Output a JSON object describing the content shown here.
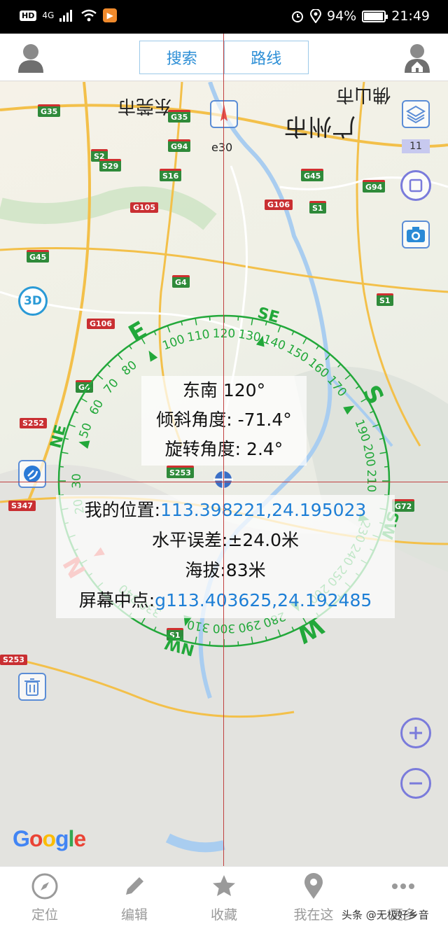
{
  "status_bar": {
    "hd": "HD",
    "network": "4G",
    "battery_text": "94%",
    "battery_level": 0.94,
    "time": "21:49"
  },
  "top_bar": {
    "search_label": "搜索",
    "route_label": "路线"
  },
  "map": {
    "layers_level": "11",
    "marker_label": "e30",
    "city_labels": [
      "东莞市",
      "广州市",
      "佛山市"
    ],
    "road_shields": [
      "G35",
      "G35",
      "G94",
      "S2",
      "S29",
      "S16",
      "G45",
      "G94",
      "G105",
      "G106",
      "S1",
      "G45",
      "G4",
      "S1",
      "G106",
      "S252",
      "S253",
      "S347",
      "G4",
      "S1",
      "S253",
      "G72"
    ],
    "compass": {
      "direction_text": "东南 120°",
      "tilt_text": "倾斜角度: -71.4°",
      "rotation_text": "旋转角度: 2.4°",
      "ticks": [
        "100",
        "110",
        "120",
        "130",
        "140",
        "150",
        "160",
        "170",
        "190",
        "200",
        "210",
        "230",
        "240",
        "250",
        "260",
        "280",
        "290",
        "300",
        "310",
        "330",
        "340",
        "20",
        "30",
        "50",
        "60",
        "70",
        "80"
      ],
      "cardinals": {
        "e": "E",
        "se": "SE",
        "s": "S",
        "sw": "SW",
        "w": "W",
        "nw": "NW",
        "n": "N",
        "ne": "NE"
      }
    },
    "info": {
      "location_label": "我的位置:",
      "location_value": "113.398221,24.195023",
      "accuracy_text": "水平误差:±24.0米",
      "altitude_text": "海拔:83米",
      "center_label": "屏幕中点:",
      "center_value": "g113.403625,24.192485"
    },
    "button_3d": "3D",
    "google": "Google",
    "colors": {
      "compass": "#22a83a",
      "north": "#e8504a",
      "blue_text": "#1e7fd6",
      "button_border": "#5b8dd6"
    }
  },
  "bottom_nav": {
    "items": [
      {
        "label": "定位",
        "icon": "compass-icon"
      },
      {
        "label": "编辑",
        "icon": "pencil-icon"
      },
      {
        "label": "收藏",
        "icon": "star-icon"
      },
      {
        "label": "我在这",
        "icon": "location-pin-icon"
      },
      {
        "label": "更多",
        "icon": "more-icon"
      }
    ],
    "watermark": "头条 @无极好乡音"
  }
}
